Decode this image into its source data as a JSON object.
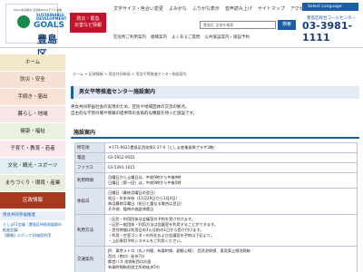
{
  "header": {
    "logo_subtitle": "SDGs未来都市 自治体SDGsモデル事業",
    "sdg_text": "SUSTAINABLE\nDEVELOPMENT",
    "sdg_big": "GOALS",
    "city_name": "豊島区",
    "disaster_label": "防災・緊急\n災害など情報",
    "top_links": [
      "文字サイズ・色合い変更",
      "よみがな",
      "ふりがな表示",
      "音声読み上げ",
      "サイトマップ",
      "アクセス"
    ],
    "language_button": "Select Language",
    "search_scope": "豊島区 全体を検索",
    "search_button": "検索",
    "call_center_label": "豊島区総合コールセンター",
    "call_center_number": "03-3981-1111",
    "subnav": [
      "区役所ご利用案内",
      "組織案内",
      "よくあるご質問",
      "公共施設案内・施設予約"
    ]
  },
  "sidebar": {
    "items": [
      {
        "label": "ホーム",
        "active": false
      },
      {
        "label": "防災・安全",
        "active": false
      },
      {
        "label": "手続き・届出",
        "active": false
      },
      {
        "label": "暮らし・地域",
        "active": false
      },
      {
        "label": "健康・福祉",
        "active": false
      },
      {
        "label": "子育て・教育・若者",
        "active": false
      },
      {
        "label": "文化・観光・スポーツ",
        "active": false
      },
      {
        "label": "まちづくり・環境・産業",
        "active": false
      },
      {
        "label": "区政情報",
        "active": true
      }
    ],
    "sub_title": "男女共同参画推進",
    "links": [
      "としまF1会議（豊島区持続発展都市推進会議）",
      "【募集】エポック10施設利用"
    ]
  },
  "breadcrumb": "ホーム > 区政情報 > 男女共同参画 > 男女平等推進センター施設案内",
  "page_title": "男女平等推進センター施設案内",
  "intro": "男女共同参画社会の実現のため、区民や地域団体の交流の拠点。\n自主的な学習の場や情報の提供等の多角的な機能を持った施設です。",
  "section_title": "施設案内",
  "info_table": [
    {
      "label": "所在地",
      "value": "〒171-0021豊島区西池袋2-37-4（としま産業振興プラザ3階）"
    },
    {
      "label": "電話",
      "value": "03-5952-9501"
    },
    {
      "label": "ファクス",
      "value": "03-5391-1015"
    },
    {
      "label": "利用時間",
      "value": "月曜日から土曜日は、午前9時から午後9時\n日曜日（第一回）は、午前9時から午後5時"
    },
    {
      "label": "休館日",
      "value": "日曜日（最終月曜日の翌日）\n祝日・年末年始（12月29日から1月4日）\n毎月最終月曜日（祝日と重なる場合は翌日）\nその他、臨時の施設休館日"
    },
    {
      "label": "利用方法",
      "value": "・区民・利用団体は会議室の予約を受け付けます。\n・区民一般団体・利用方法は会議室を利用することができます。\n・受付時間は利用日の3ヵ月前の1日から受け付けます。\n・利用・空室ゴンダーの所在および会議室の予約は下記より。\n・上記専用予約システムをご利用ください。"
    },
    {
      "label": "交通案内",
      "value": "JR、東京メトロ（丸ノ内線、有楽町線、副都心線）、西武池袋線、東武東上線池袋駅\n西口（南口）徒歩7分\n都営バス 池袋駅西口方面\n有楽町線駅前加工所前徒歩5分"
    }
  ],
  "colors": {
    "brand_blue": "#1a5ea8",
    "active_menu": "#a73a1e",
    "disaster_red": "#c4132b"
  }
}
